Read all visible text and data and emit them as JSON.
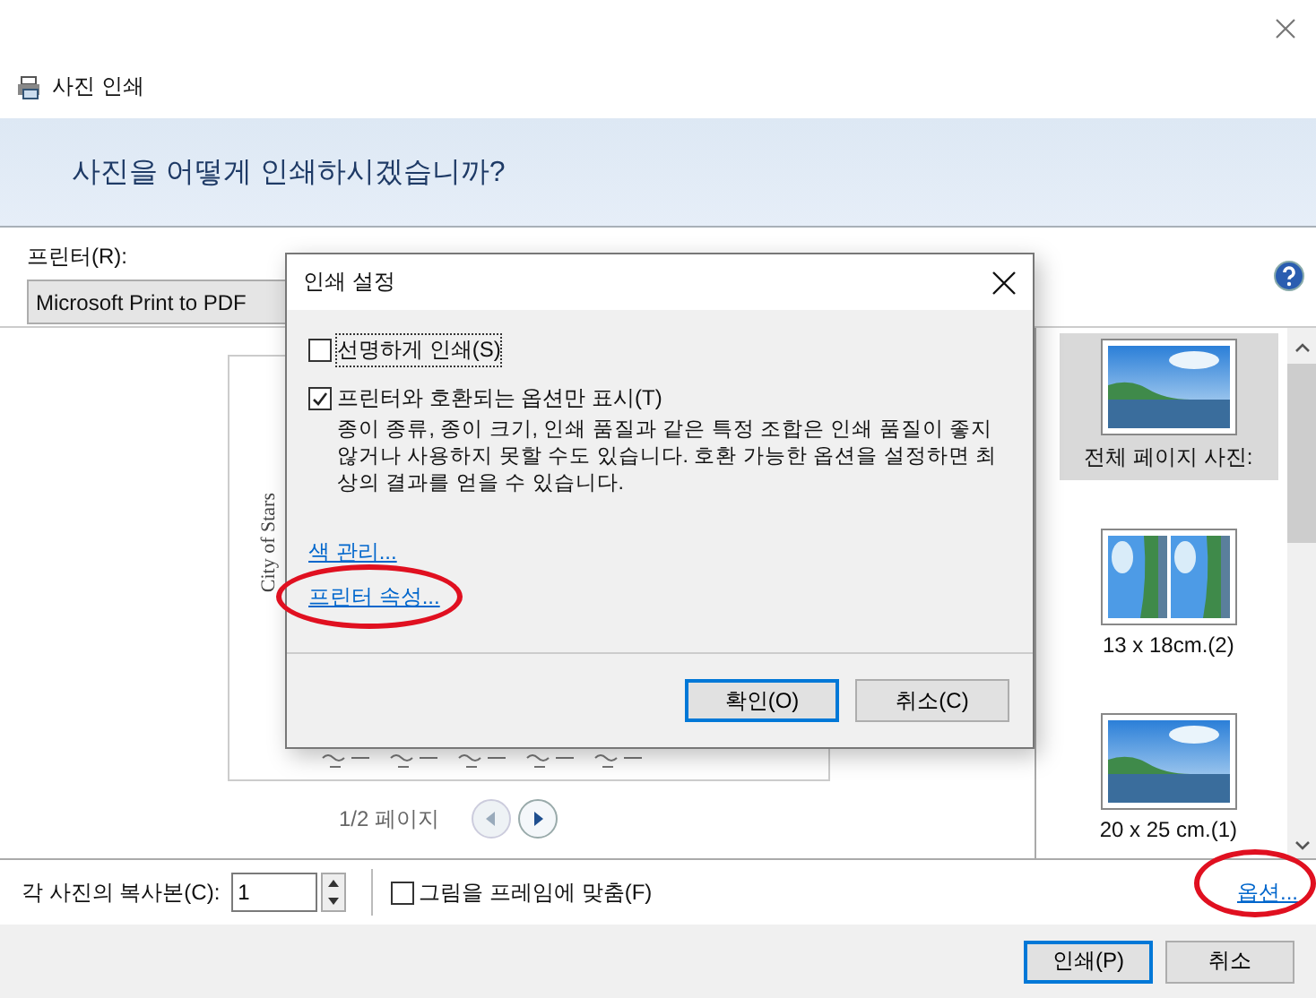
{
  "window": {
    "title": "사진 인쇄"
  },
  "header": {
    "question": "사진을 어떻게 인쇄하시겠습니까?"
  },
  "printer": {
    "label": "프린터(R):",
    "value": "Microsoft Print to PDF"
  },
  "preview": {
    "page_text": "City of Stars",
    "page_indicator": "1/2 페이지",
    "prev_disabled": true
  },
  "layouts": [
    {
      "label": "전체 페이지 사진:",
      "kind": "single",
      "selected": true
    },
    {
      "label": "13 x 18cm.(2)",
      "kind": "double",
      "selected": false
    },
    {
      "label": "20 x 25 cm.(1)",
      "kind": "single",
      "selected": false
    }
  ],
  "copies": {
    "label": "각 사진의 복사본(C):",
    "value": "1"
  },
  "fit_frame": {
    "label": "그림을 프레임에 맞춤(F)",
    "checked": false
  },
  "options_link": {
    "label": "옵션...",
    "circled": true
  },
  "buttons": [
    {
      "label": "인쇄(P)",
      "default": true
    },
    {
      "label": "취소",
      "default": false
    }
  ],
  "dialog": {
    "title": "인쇄 설정",
    "options": [
      {
        "label": "선명하게 인쇄(S)",
        "checked": false,
        "focused": true
      },
      {
        "label": "프린터와 호환되는 옵션만 표시(T)",
        "checked": true,
        "focused": false,
        "description": "종이 종류, 종이 크기, 인쇄 품질과 같은 특정 조합은 인쇄 품질이 좋지 않거나 사용하지 못할 수도 있습니다. 호환 가능한 옵션을 설정하면 최상의 결과를 얻을 수 있습니다."
      }
    ],
    "links": [
      {
        "label": "색 관리...",
        "circled": false
      },
      {
        "label": "프린터 속성...",
        "circled": true
      }
    ],
    "buttons": [
      {
        "label": "확인(O)",
        "default": true
      },
      {
        "label": "취소(C)",
        "default": false
      }
    ]
  }
}
